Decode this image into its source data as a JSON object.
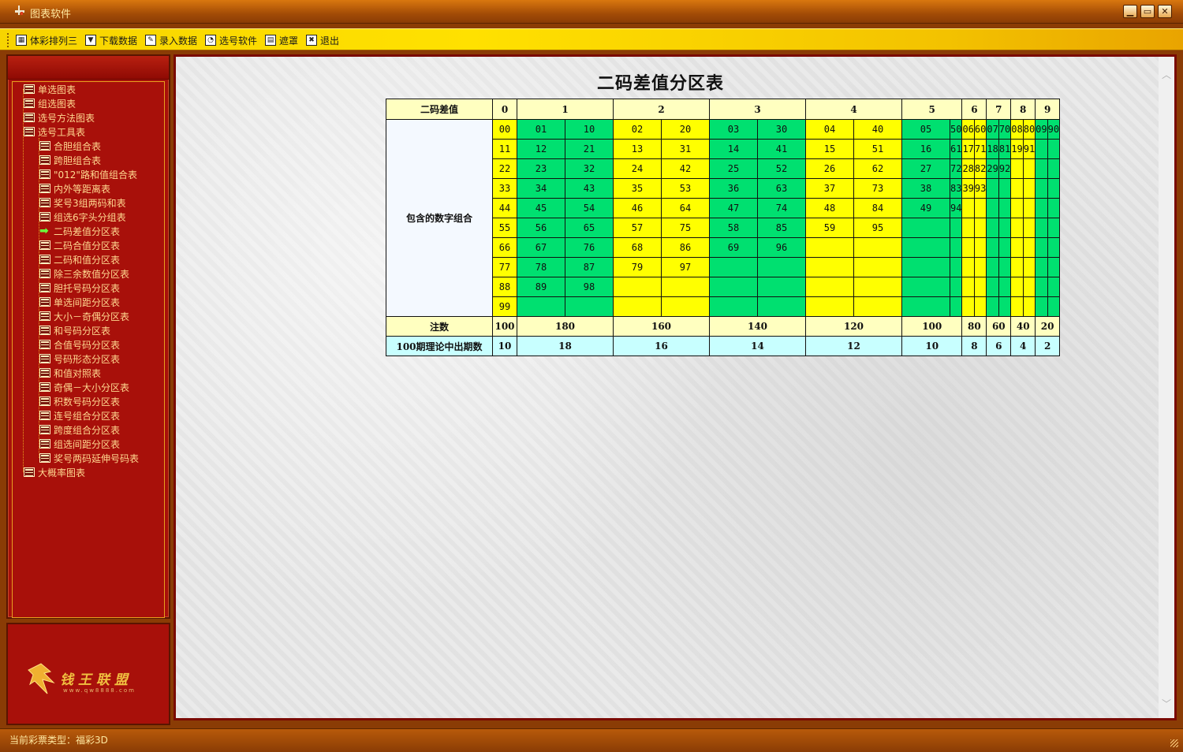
{
  "window": {
    "title": "图表软件",
    "controls": [
      "minimize",
      "restore",
      "close"
    ]
  },
  "toolbar": {
    "items": [
      {
        "label": "体彩排列三",
        "icon": "table-icon"
      },
      {
        "label": "下载数据",
        "icon": "download-icon"
      },
      {
        "label": "录入数据",
        "icon": "pencil-icon"
      },
      {
        "label": "选号软件",
        "icon": "chart-icon"
      },
      {
        "label": "遮罩",
        "icon": "document-icon"
      },
      {
        "label": "退出",
        "icon": "close-icon"
      }
    ]
  },
  "tree": {
    "roots": [
      {
        "label": "单选图表",
        "icon": "folder-stack-icon"
      },
      {
        "label": "组选图表",
        "icon": "folder-stack-icon"
      },
      {
        "label": "选号方法图表",
        "icon": "folder-stack-icon"
      },
      {
        "label": "选号工具表",
        "icon": "folder-stack-icon"
      }
    ],
    "children": [
      {
        "label": "合胆组合表"
      },
      {
        "label": "跨胆组合表"
      },
      {
        "label": "\"012\"路和值组合表"
      },
      {
        "label": "内外等距离表"
      },
      {
        "label": "奖号3组两码和表"
      },
      {
        "label": "组选6字头分组表"
      },
      {
        "label": "二码差值分区表",
        "selected": true
      },
      {
        "label": "二码合值分区表"
      },
      {
        "label": "二码和值分区表"
      },
      {
        "label": "除三余数值分区表"
      },
      {
        "label": "胆托号码分区表"
      },
      {
        "label": "单选间距分区表"
      },
      {
        "label": "大小－奇偶分区表"
      },
      {
        "label": "和号码分区表"
      },
      {
        "label": "合值号码分区表"
      },
      {
        "label": "号码形态分区表"
      },
      {
        "label": "和值对照表"
      },
      {
        "label": "奇偶－大小分区表"
      },
      {
        "label": "积数号码分区表"
      },
      {
        "label": "连号组合分区表"
      },
      {
        "label": "跨度组合分区表"
      },
      {
        "label": "组选间距分区表"
      },
      {
        "label": "奖号两码延伸号码表"
      }
    ],
    "last": {
      "label": "大概率图表"
    }
  },
  "logo": {
    "text": "钱王联盟",
    "url": "www.qw8888.com"
  },
  "main": {
    "title": "二码差值分区表",
    "header_label": "二码差值",
    "diff_values": [
      "0",
      "1",
      "2",
      "3",
      "4",
      "5",
      "6",
      "7",
      "8",
      "9"
    ],
    "combo_label": "包含的数字组合",
    "count_label": "注数",
    "counts": [
      "100",
      "180",
      "160",
      "140",
      "120",
      "100",
      "80",
      "60",
      "40",
      "20"
    ],
    "expected_label": "100期理论中出期数",
    "expected": [
      "10",
      "18",
      "16",
      "14",
      "12",
      "10",
      "8",
      "6",
      "4",
      "2"
    ],
    "colors": {
      "yellow": "#ffff00",
      "green": "#00e070",
      "header": "#ffffc0",
      "expected": "#c8ffff"
    },
    "combos": [
      [
        "00",
        "11",
        "22",
        "33",
        "44",
        "55",
        "66",
        "77",
        "88",
        "99"
      ],
      [
        [
          "01",
          "10"
        ],
        [
          "12",
          "21"
        ],
        [
          "23",
          "32"
        ],
        [
          "34",
          "43"
        ],
        [
          "45",
          "54"
        ],
        [
          "56",
          "65"
        ],
        [
          "67",
          "76"
        ],
        [
          "78",
          "87"
        ],
        [
          "89",
          "98"
        ]
      ],
      [
        [
          "02",
          "20"
        ],
        [
          "13",
          "31"
        ],
        [
          "24",
          "42"
        ],
        [
          "35",
          "53"
        ],
        [
          "46",
          "64"
        ],
        [
          "57",
          "75"
        ],
        [
          "68",
          "86"
        ],
        [
          "79",
          "97"
        ]
      ],
      [
        [
          "03",
          "30"
        ],
        [
          "14",
          "41"
        ],
        [
          "25",
          "52"
        ],
        [
          "36",
          "63"
        ],
        [
          "47",
          "74"
        ],
        [
          "58",
          "85"
        ],
        [
          "69",
          "96"
        ]
      ],
      [
        [
          "04",
          "40"
        ],
        [
          "15",
          "51"
        ],
        [
          "26",
          "62"
        ],
        [
          "37",
          "73"
        ],
        [
          "48",
          "84"
        ],
        [
          "59",
          "95"
        ]
      ],
      [
        [
          "05",
          "50"
        ],
        [
          "16",
          "61"
        ],
        [
          "27",
          "72"
        ],
        [
          "38",
          "83"
        ],
        [
          "49",
          "94"
        ]
      ],
      [
        [
          "06",
          "60"
        ],
        [
          "17",
          "71"
        ],
        [
          "28",
          "82"
        ],
        [
          "39",
          "93"
        ]
      ],
      [
        [
          "07",
          "70"
        ],
        [
          "18",
          "81"
        ],
        [
          "29",
          "92"
        ]
      ],
      [
        [
          "08",
          "80"
        ],
        [
          "19",
          "91"
        ]
      ],
      [
        [
          "09",
          "90"
        ]
      ]
    ]
  },
  "status": {
    "text": "当前彩票类型：福彩3D"
  }
}
